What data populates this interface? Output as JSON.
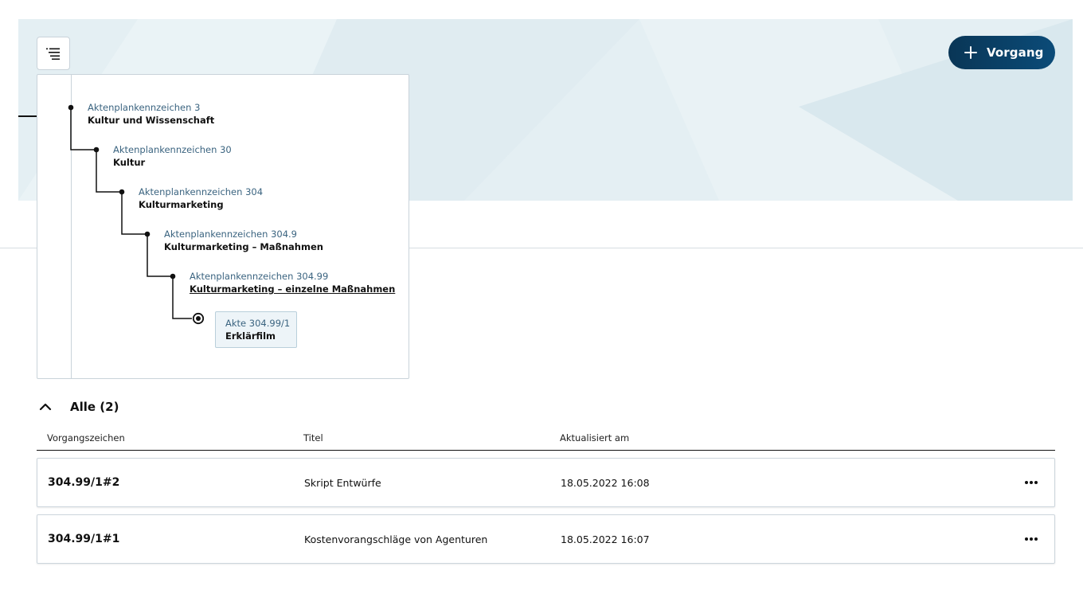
{
  "header": {
    "new_button_label": "Vorgang",
    "menu_icon": "filter-list-icon",
    "plus_icon": "plus-icon"
  },
  "tree": {
    "levels": [
      {
        "code": "Aktenplankennzeichen 3",
        "name": "Kultur und Wissenschaft"
      },
      {
        "code": "Aktenplankennzeichen 30",
        "name": "Kultur"
      },
      {
        "code": "Aktenplankennzeichen 304",
        "name": "Kulturmarketing"
      },
      {
        "code": "Aktenplankennzeichen 304.9",
        "name": "Kulturmarketing – Maßnahmen"
      },
      {
        "code": "Aktenplankennzeichen 304.99",
        "name": "Kulturmarketing – einzelne Maßnahmen"
      }
    ],
    "current": {
      "code": "Akte 304.99/1",
      "name": "Erklärfilm"
    }
  },
  "group": {
    "label": "Alle (2)",
    "chevron_icon": "chevron-up-icon"
  },
  "table": {
    "columns": [
      "Vorgangszeichen",
      "Titel",
      "Aktualisiert am"
    ],
    "rows": [
      {
        "id": "304.99/1#2",
        "title": "Skript Entwürfe",
        "updated": "18.05.2022 16:08"
      },
      {
        "id": "304.99/1#1",
        "title": "Kostenvorangschläge von Agenturen",
        "updated": "18.05.2022 16:07"
      }
    ],
    "row_menu_icon": "more-horizontal-icon"
  },
  "colors": {
    "primary": "#0a3f63",
    "hero_background": "#e4eff3",
    "tree_code_text": "#3b6480"
  }
}
